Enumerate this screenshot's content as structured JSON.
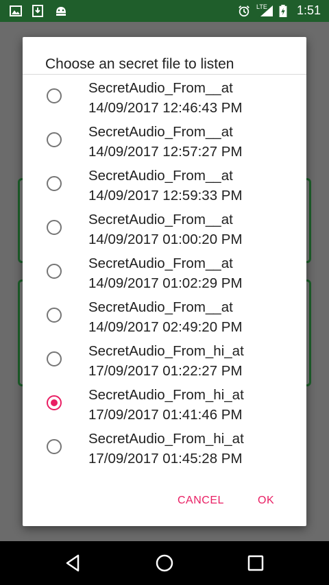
{
  "status_bar": {
    "time": "1:51",
    "network": "LTE",
    "icons": [
      "image-icon",
      "download-icon",
      "android-icon",
      "alarm-icon",
      "signal-icon",
      "battery-charging-icon"
    ]
  },
  "dialog": {
    "title": "Choose an secret file to listen",
    "items": [
      {
        "line1": "SecretAudio_From__at",
        "line2": "14/09/2017 12:46:43 PM",
        "checked": false
      },
      {
        "line1": "SecretAudio_From__at",
        "line2": "14/09/2017 12:57:27 PM",
        "checked": false
      },
      {
        "line1": "SecretAudio_From__at",
        "line2": "14/09/2017 12:59:33 PM",
        "checked": false
      },
      {
        "line1": "SecretAudio_From__at",
        "line2": "14/09/2017 01:00:20 PM",
        "checked": false
      },
      {
        "line1": "SecretAudio_From__at",
        "line2": "14/09/2017 01:02:29 PM",
        "checked": false
      },
      {
        "line1": "SecretAudio_From__at",
        "line2": "14/09/2017 02:49:20 PM",
        "checked": false
      },
      {
        "line1": "SecretAudio_From_hi_at",
        "line2": "17/09/2017 01:22:27 PM",
        "checked": false
      },
      {
        "line1": "SecretAudio_From_hi_at",
        "line2": "17/09/2017 01:41:46 PM",
        "checked": true
      },
      {
        "line1": "SecretAudio_From_hi_at",
        "line2": "17/09/2017 01:45:28 PM",
        "checked": false
      }
    ],
    "cancel_label": "CANCEL",
    "ok_label": "OK"
  },
  "colors": {
    "accent": "#e91e63",
    "status_bar": "#1f5e2b"
  }
}
